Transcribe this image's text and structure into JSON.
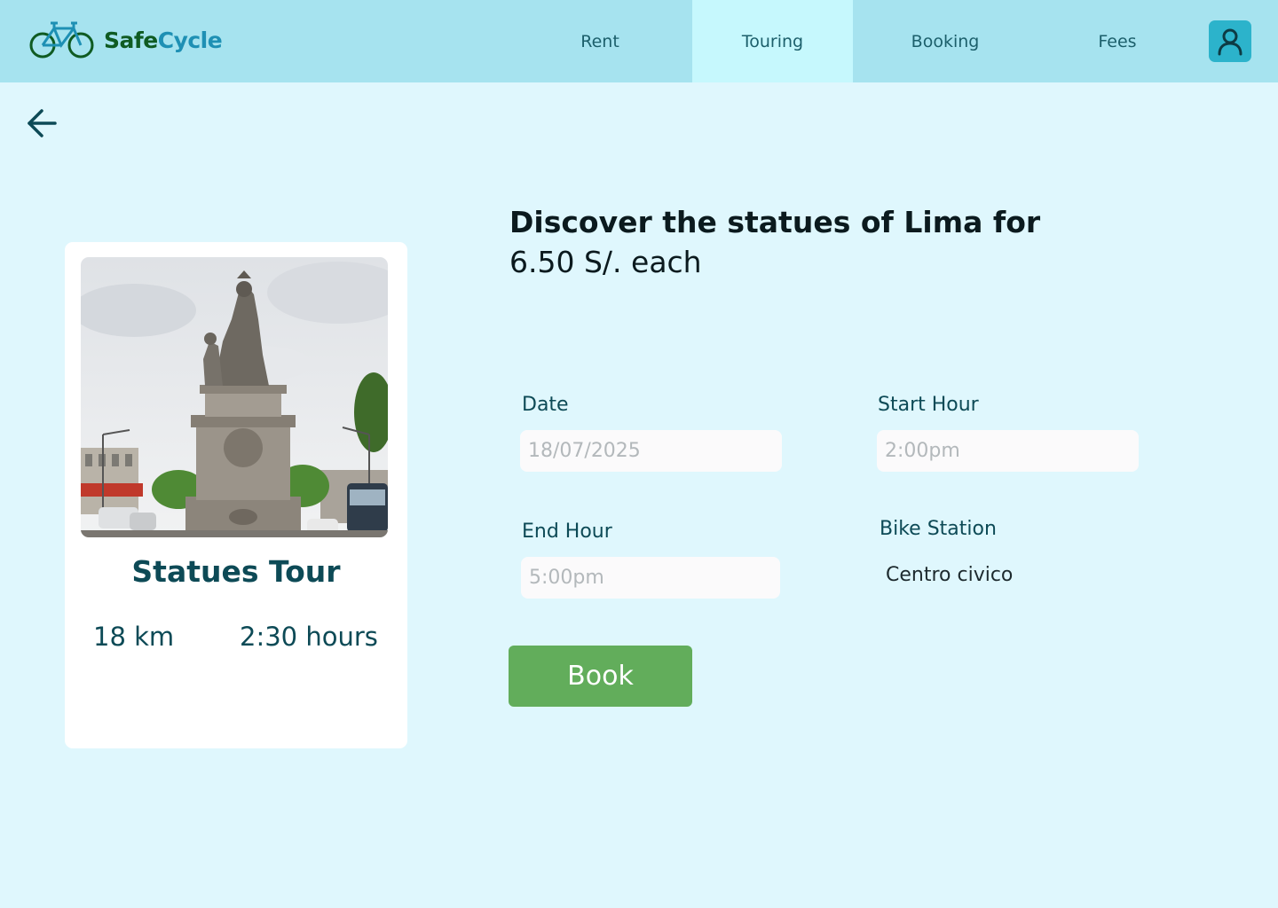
{
  "app": {
    "brand_part1": "Safe",
    "brand_part2": "Cycle",
    "brand_colors": {
      "safe": "#0f5b22",
      "cycle": "#1e90b4"
    }
  },
  "nav": {
    "items": [
      {
        "label": "Rent",
        "active": false
      },
      {
        "label": "Touring",
        "active": true
      },
      {
        "label": "Booking",
        "active": false
      },
      {
        "label": "Fees",
        "active": false
      }
    ]
  },
  "icons": {
    "logo": "bicycle-icon",
    "user": "user-icon",
    "back": "arrow-left-icon"
  },
  "tour": {
    "title": "Statues Tour",
    "distance": "18 km",
    "duration": "2:30 hours",
    "photo": "statue-photo"
  },
  "heading": {
    "line1": "Discover the statues of Lima for",
    "line2": "6.50 S/. each"
  },
  "form": {
    "date": {
      "label": "Date",
      "placeholder": "18/07/2025"
    },
    "start_hour": {
      "label": "Start Hour",
      "placeholder": "2:00pm"
    },
    "end_hour": {
      "label": "End Hour",
      "placeholder": "5:00pm"
    },
    "bike_station": {
      "label": "Bike Station",
      "value": "Centro civico"
    },
    "book_label": "Book"
  },
  "colors": {
    "background": "#dff7fd",
    "header": "#a6e3ef",
    "active_tab": "#c6f8fd",
    "user_button": "#2cb3cb",
    "book_button": "#62ad5b",
    "text_primary": "#0d4a56"
  }
}
